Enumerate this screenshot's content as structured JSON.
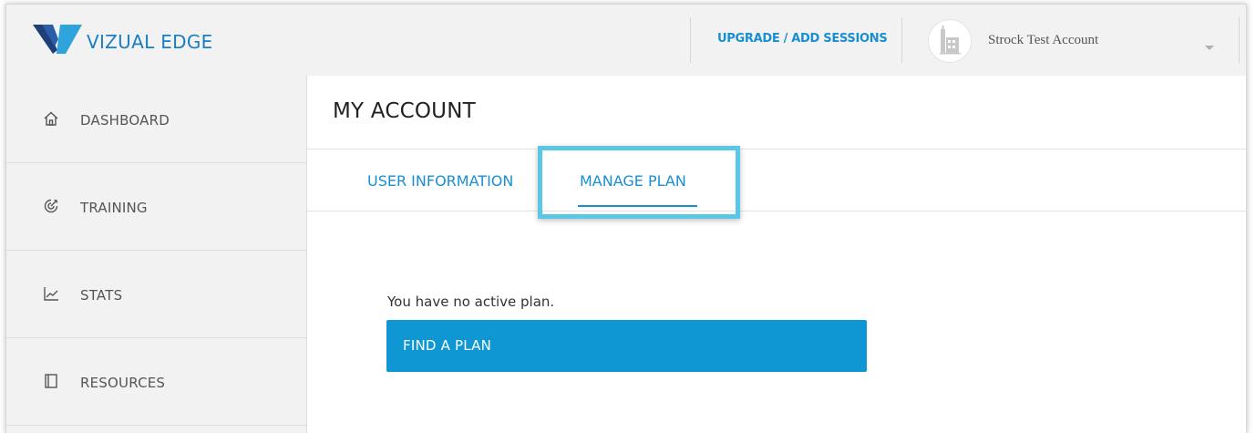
{
  "header": {
    "brand": "VIZUAL EDGE",
    "upgrade_link": "UPGRADE / ADD SESSIONS",
    "account_name": "Strock Test Account"
  },
  "sidebar": {
    "items": [
      {
        "label": "DASHBOARD",
        "icon": "home-icon"
      },
      {
        "label": "TRAINING",
        "icon": "target-icon"
      },
      {
        "label": "STATS",
        "icon": "chart-line-icon"
      },
      {
        "label": "RESOURCES",
        "icon": "book-icon"
      }
    ]
  },
  "main": {
    "title": "MY ACCOUNT",
    "tabs": [
      {
        "label": "USER INFORMATION",
        "active": false
      },
      {
        "label": "MANAGE PLAN",
        "active": true
      }
    ],
    "no_plan_text": "You have no active plan.",
    "find_plan_button": "FIND A PLAN"
  },
  "colors": {
    "accent": "#1a8fd0",
    "button": "#0f97d3",
    "highlight": "#5bc7e6",
    "sidebar_bg": "#f2f2f2"
  }
}
